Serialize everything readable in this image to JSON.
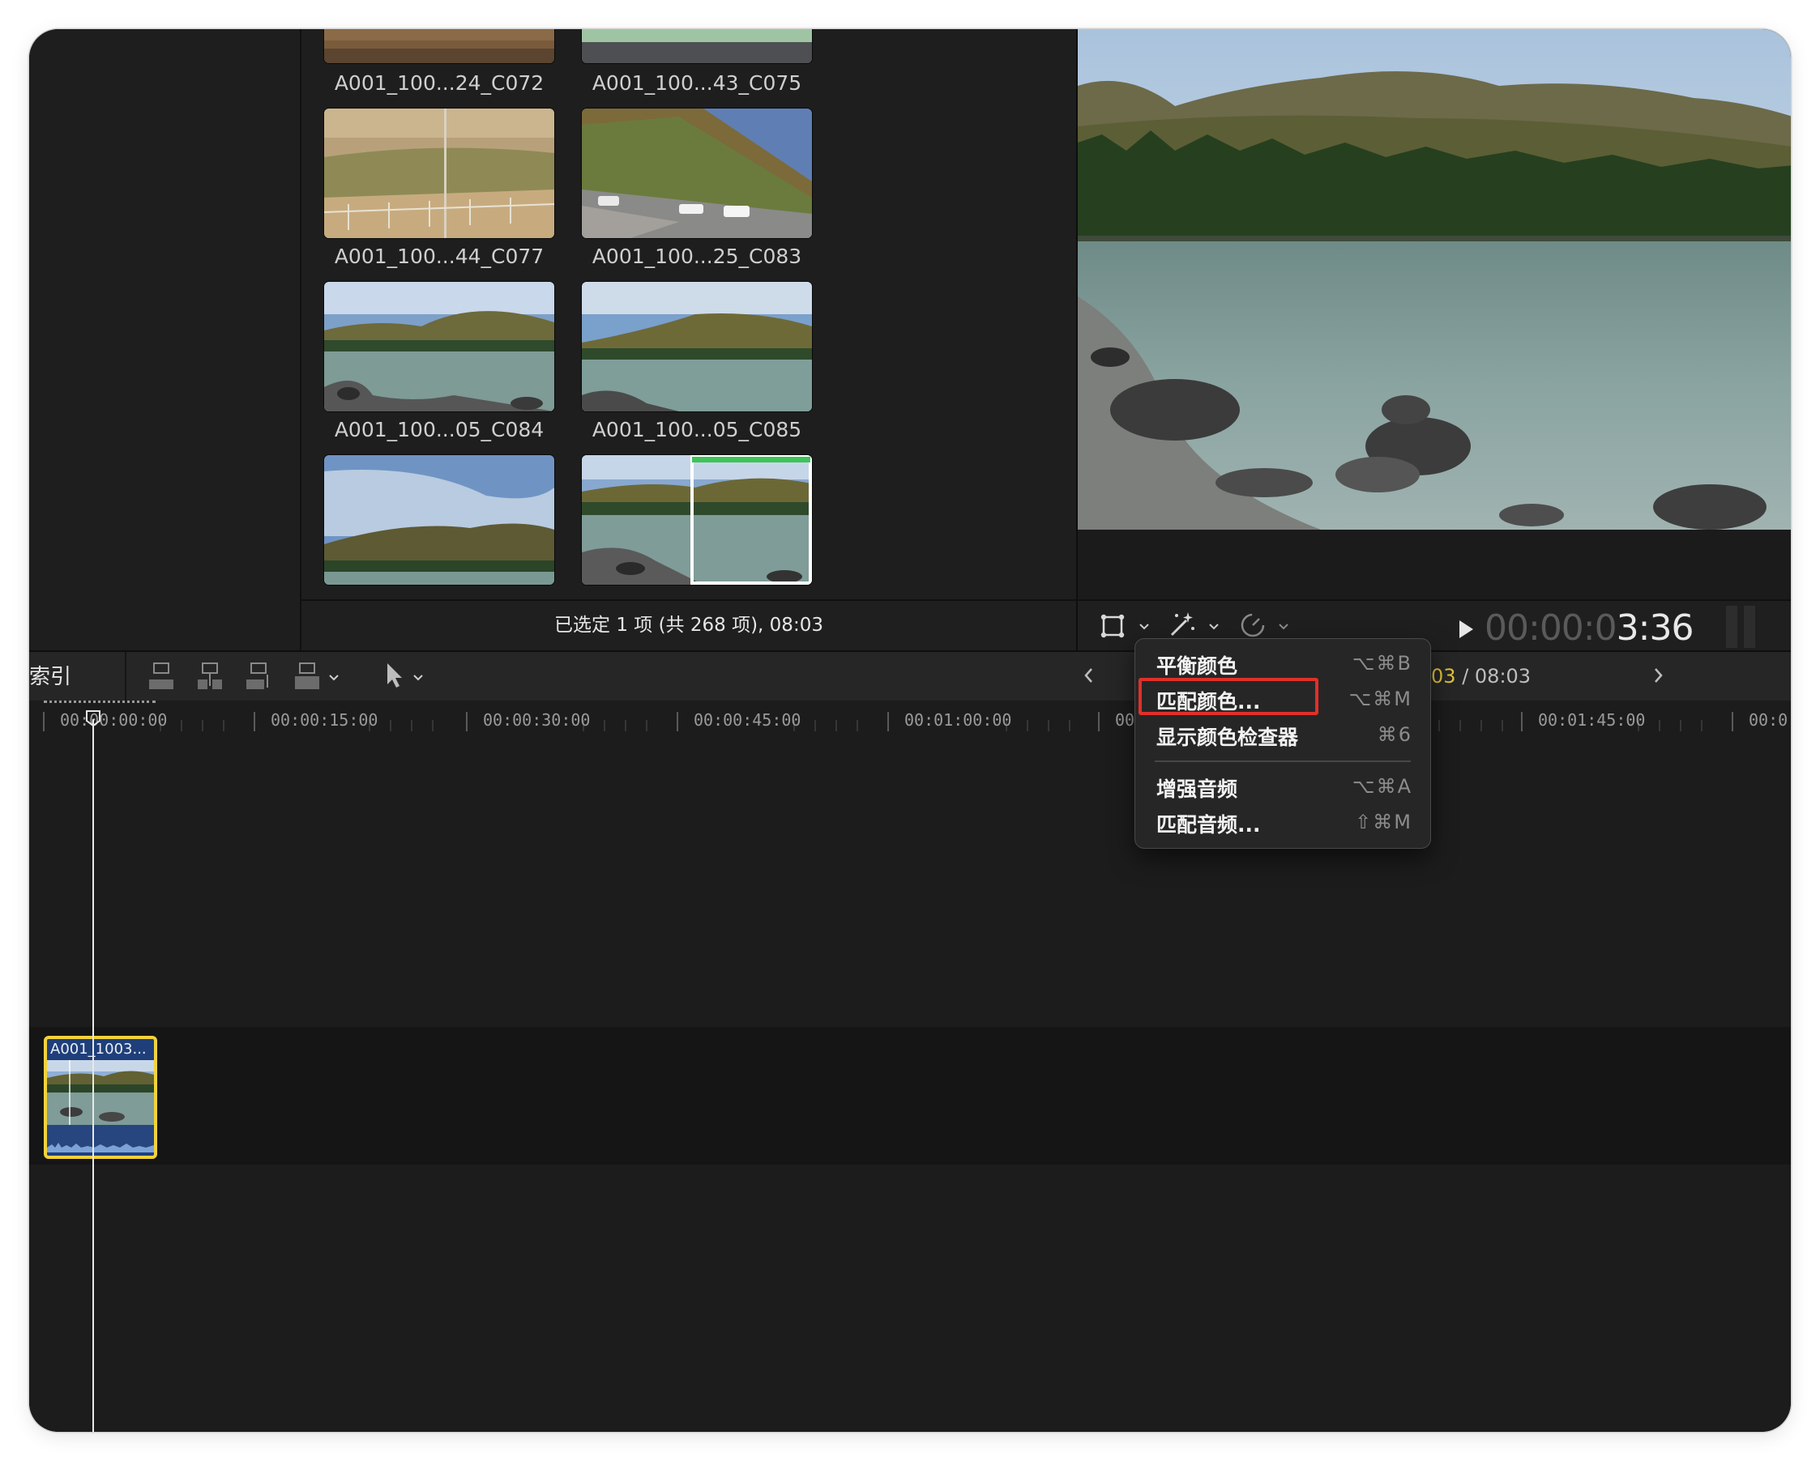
{
  "browser": {
    "clips": [
      {
        "name": "A001_100...24_C072"
      },
      {
        "name": "A001_100...43_C075"
      },
      {
        "name": "A001_100...44_C077"
      },
      {
        "name": "A001_100...25_C083"
      },
      {
        "name": "A001_100...05_C084"
      },
      {
        "name": "A001_100...05_C085"
      },
      {
        "name": ""
      },
      {
        "name": ""
      }
    ],
    "status": "已选定 1 项 (共 268 项), 08:03"
  },
  "viewer": {
    "timecode_dim": "00:00:0",
    "timecode_bright": "3:36",
    "colors": {
      "accent_green": "#3fc35a"
    }
  },
  "timeline": {
    "index_label": "索引",
    "time_current": "03",
    "time_total": "/ 08:03",
    "ruler": [
      "00:00:00:00",
      "00:00:15:00",
      "00:00:30:00",
      "00:00:45:00",
      "00:01:00:00",
      "00",
      "00:01:45:00",
      "00:0"
    ],
    "clip": {
      "name": "A001_1003...",
      "border": "#f3d23a"
    }
  },
  "menu": {
    "items": [
      {
        "label": "平衡颜色",
        "shortcut": "⌥⌘B"
      },
      {
        "label": "匹配颜色...",
        "shortcut": "⌥⌘M",
        "highlighted": true
      },
      {
        "label": "显示颜色检查器",
        "shortcut": "⌘6"
      },
      {
        "label": "增强音频",
        "shortcut": "⌥⌘A"
      },
      {
        "label": "匹配音频...",
        "shortcut": "⇧⌘M"
      }
    ],
    "highlight_color": "#e0302a"
  }
}
